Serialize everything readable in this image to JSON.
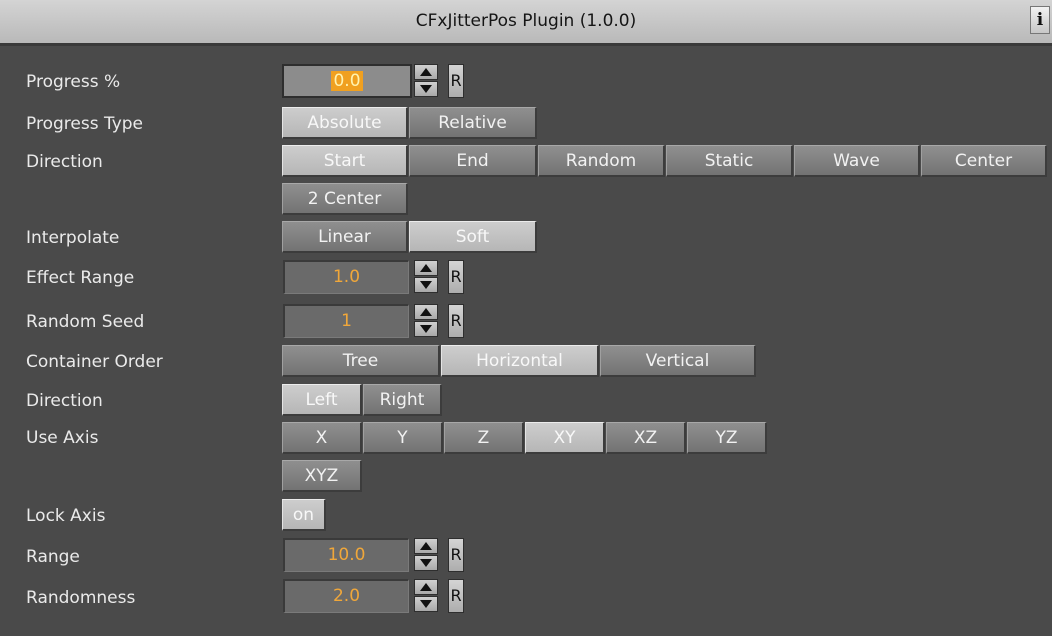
{
  "window": {
    "title": "CFxJitterPos Plugin (1.0.0)",
    "info_label": "i"
  },
  "rows": {
    "progress_pct": {
      "label": "Progress %",
      "value": "0.0",
      "reset": "R"
    },
    "progress_type": {
      "label": "Progress Type",
      "options": [
        "Absolute",
        "Relative"
      ],
      "selected": "Absolute"
    },
    "direction": {
      "label": "Direction",
      "options": [
        "Start",
        "End",
        "Random",
        "Static",
        "Wave",
        "Center",
        "2 Center"
      ],
      "selected": "Start"
    },
    "interpolate": {
      "label": "Interpolate",
      "options": [
        "Linear",
        "Soft"
      ],
      "selected": "Soft"
    },
    "effect_range": {
      "label": "Effect Range",
      "value": "1.0",
      "reset": "R"
    },
    "random_seed": {
      "label": "Random Seed",
      "value": "1",
      "reset": "R"
    },
    "container_order": {
      "label": "Container Order",
      "options": [
        "Tree",
        "Horizontal",
        "Vertical"
      ],
      "selected": "Horizontal"
    },
    "direction2": {
      "label": "Direction",
      "options": [
        "Left",
        "Right"
      ],
      "selected": "Left"
    },
    "use_axis": {
      "label": "Use Axis",
      "options": [
        "X",
        "Y",
        "Z",
        "XY",
        "XZ",
        "YZ",
        "XYZ"
      ],
      "selected": "XY"
    },
    "lock_axis": {
      "label": "Lock Axis",
      "toggle": "on"
    },
    "range": {
      "label": "Range",
      "value": "10.0",
      "reset": "R"
    },
    "randomness": {
      "label": "Randomness",
      "value": "2.0",
      "reset": "R"
    }
  }
}
